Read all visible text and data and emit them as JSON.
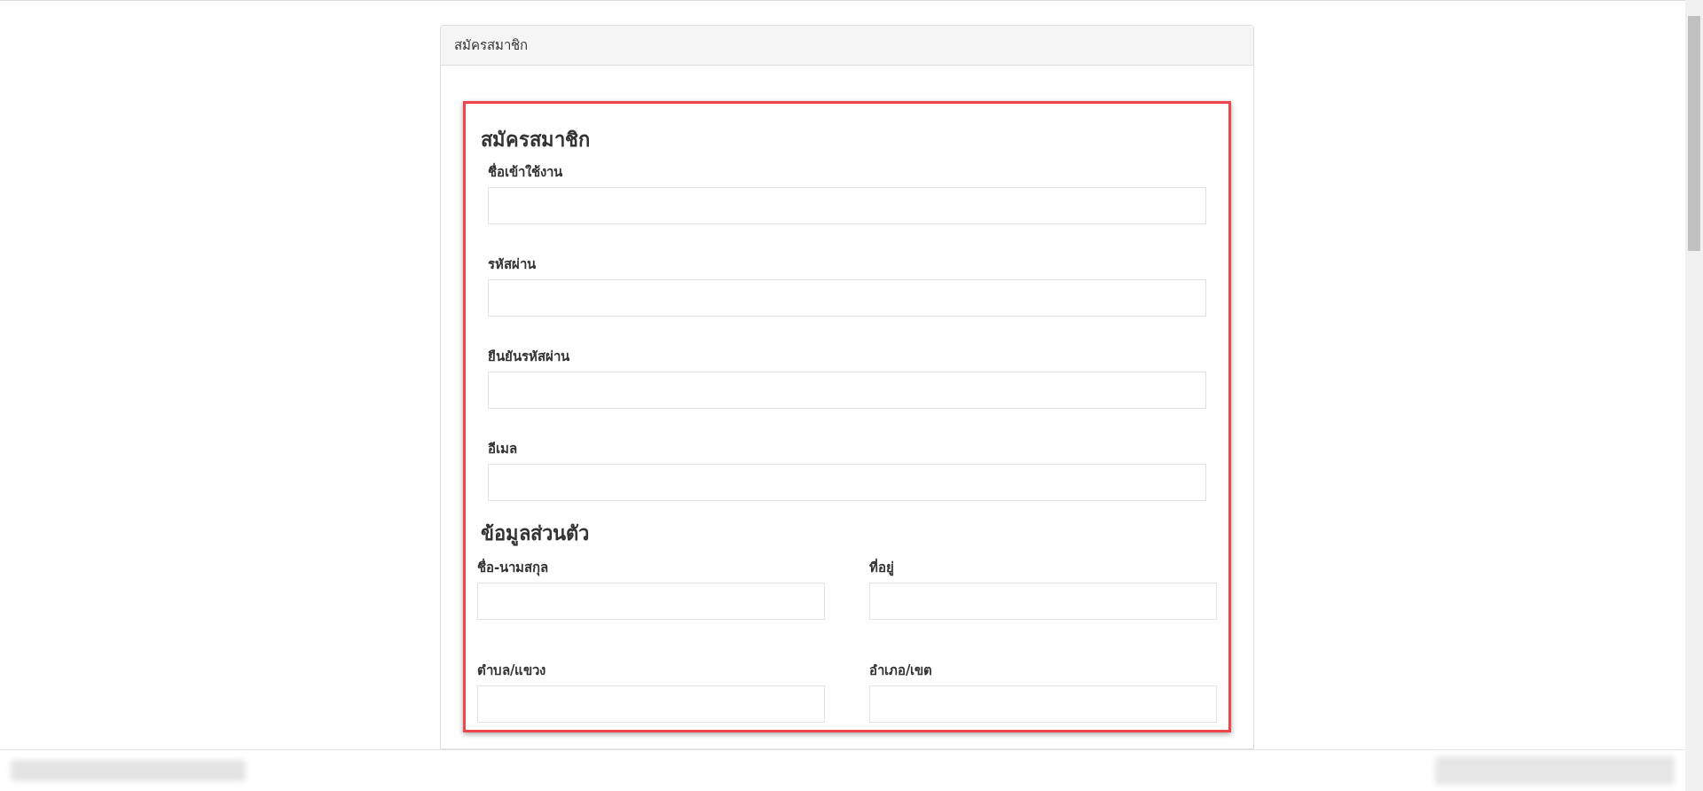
{
  "panel": {
    "title": "สมัครสมาชิก"
  },
  "form": {
    "title": "สมัครสมาชิก",
    "fields": [
      {
        "label": "ชื่อเข้าใช้งาน"
      },
      {
        "label": "รหัสผ่าน"
      },
      {
        "label": "ยืนยันรหัสผ่าน"
      },
      {
        "label": "อีเมล"
      }
    ]
  },
  "personal": {
    "title": "ข้อมูลส่วนตัว",
    "fields": [
      {
        "label": "ชื่อ-นามสกุล"
      },
      {
        "label": "ที่อยู่"
      },
      {
        "label": "ตำบล/แขวง"
      },
      {
        "label": "อำเภอ/เขต"
      }
    ]
  }
}
